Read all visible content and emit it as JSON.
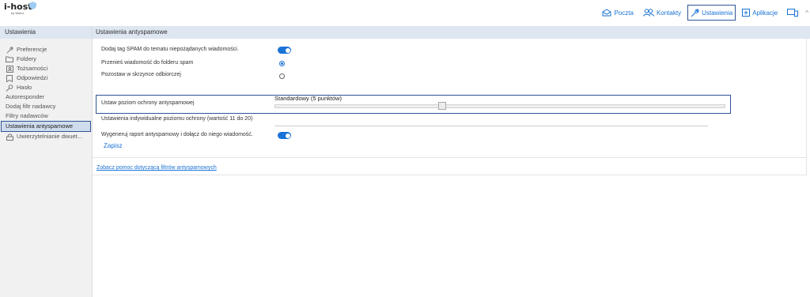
{
  "brand": {
    "name": "i-host",
    "sub": "by Webd"
  },
  "topnav": {
    "items": [
      {
        "label": "Poczta",
        "icon": "mail-icon"
      },
      {
        "label": "Kontakty",
        "icon": "contacts-icon"
      },
      {
        "label": "Ustawienia",
        "icon": "wrench-icon",
        "active": true
      },
      {
        "label": "Aplikacje",
        "icon": "plus-box-icon"
      },
      {
        "label": "",
        "icon": "devices-icon"
      }
    ],
    "more": "^"
  },
  "sidebar": {
    "title": "Ustawienia",
    "items": [
      {
        "label": "Preferencje",
        "icon": "wrench-icon"
      },
      {
        "label": "Foldery",
        "icon": "folder-icon"
      },
      {
        "label": "Tożsamości",
        "icon": "id-card-icon"
      },
      {
        "label": "Odpowiedzi",
        "icon": "note-icon"
      },
      {
        "label": "Hasło",
        "icon": "key-icon"
      },
      {
        "label": "Autoresponder",
        "icon": ""
      },
      {
        "label": "Dodaj filtr nadawcy",
        "icon": ""
      },
      {
        "label": "Filtry nadawców",
        "icon": ""
      },
      {
        "label": "Ustawienia antyspamowe",
        "icon": "",
        "active": true
      },
      {
        "label": "Uwierzytelnianie dwuet...",
        "icon": "lock-icon"
      }
    ]
  },
  "main": {
    "title": "Ustawienia antyspamowe",
    "rows": {
      "spam_tag": {
        "label": "Dodaj tag SPAM do tematu niepożądanych wiadomości.",
        "enabled": true
      },
      "move_spam": {
        "label": "Przenieś wiadomość do folderu spam",
        "selected": true
      },
      "keep_inbox": {
        "label": "Pozostaw w skrzynce odbiorczej",
        "selected": false
      },
      "protection": {
        "label": "Ustaw poziom ochrony antyspamowej",
        "value_label": "Standardowy (5 punktów)",
        "level_fraction": 0.37
      },
      "individual": {
        "label": "Ustawienia indywidualne poziomu ochrony (wartość 11 do 20)",
        "value": ""
      },
      "report": {
        "label": "Wygeneruj raport antyspamowy i dołącz do niego wiadomość.",
        "enabled": true
      }
    },
    "save_label": "Zapisz",
    "help_link": "Zobacz pomoc dotyczącą filtrów antyspamowych"
  },
  "colors": {
    "accent": "#1a73d6",
    "header_bg": "#dde6f1",
    "highlight": "#2f5597"
  }
}
